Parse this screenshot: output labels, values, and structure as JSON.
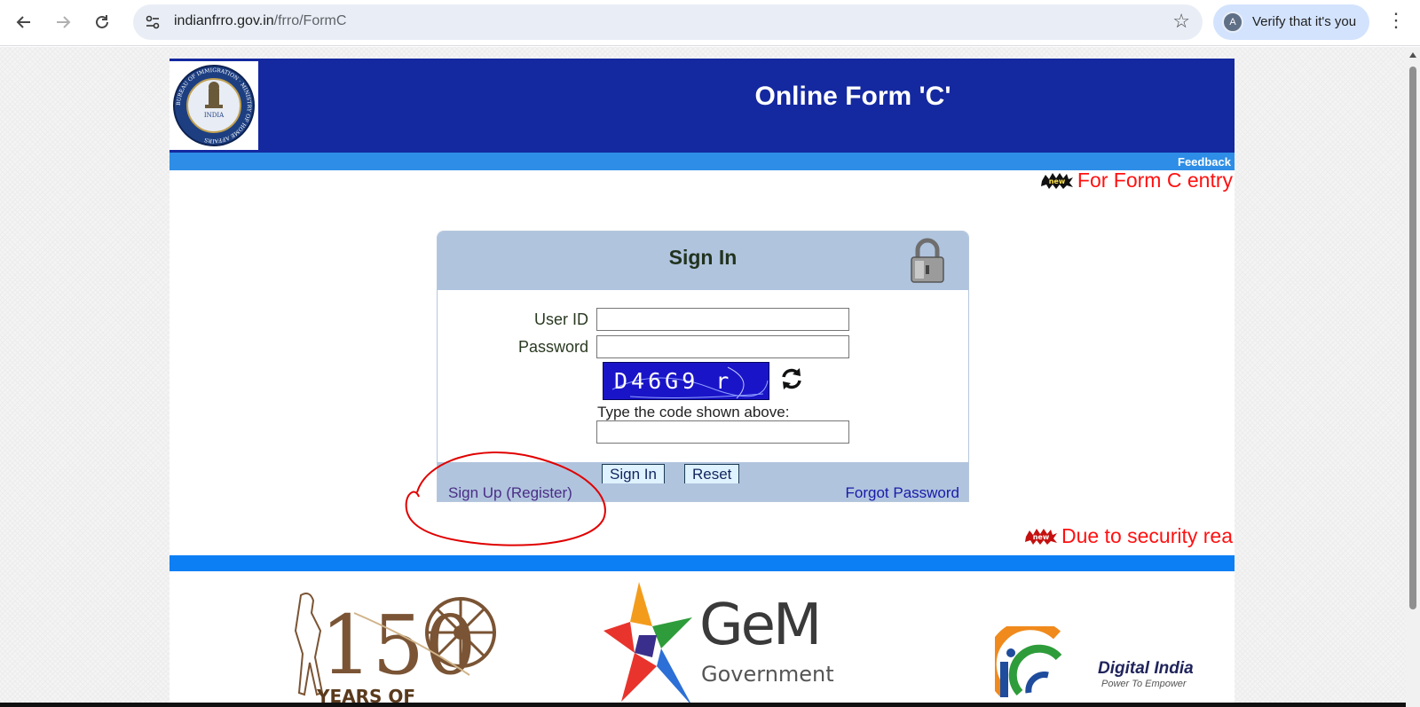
{
  "browser": {
    "url_host": "indianfrro.gov.in",
    "url_path": "/frro/FormC",
    "profile_label": "Verify that it's you",
    "avatar_letter": "A"
  },
  "header": {
    "title": "Online Form 'C'",
    "feedback_label": "Feedback",
    "emblem_ring_text": "BUREAU OF IMMIGRATION · MINISTRY OF HOME AFFAIRS",
    "emblem_center_text": "INDIA"
  },
  "tickers": [
    {
      "badge": "new",
      "text": "For Form C entry"
    },
    {
      "badge": "new",
      "text": "Due to security rea"
    }
  ],
  "login": {
    "title": "Sign In",
    "user_id_label": "User ID",
    "password_label": "Password",
    "captcha_code": "D46G9 r",
    "captcha_hint": "Type the code shown above:",
    "sign_in_button": "Sign In",
    "reset_button": "Reset",
    "sign_up_link": "Sign Up (Register)",
    "forgot_password_link": "Forgot Password"
  },
  "footer_logos": {
    "gandhi_number": "150",
    "gandhi_text": "YEARS OF",
    "gem_name": "GeM",
    "gem_sub": "Government",
    "digital_india_title": "Digital India",
    "digital_india_tagline": "Power To Empower"
  },
  "colors": {
    "header_bg": "#1428a0",
    "feedback_bar": "#2e8de6",
    "ticker_red": "#ff1111",
    "panel_bg": "#b0c4de",
    "annotation_red": "#e00000"
  }
}
